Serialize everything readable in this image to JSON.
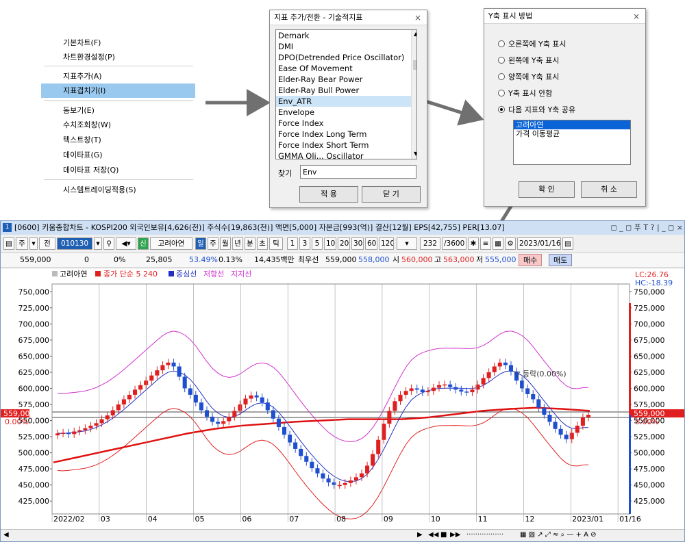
{
  "context_menu": {
    "items": [
      {
        "label": "기본차트(F)"
      },
      {
        "label": "차트환경설정(P)"
      },
      {
        "label": "지표추가(A)"
      },
      {
        "label": "지표겹치기(I)"
      },
      {
        "label": "동보기(E)"
      },
      {
        "label": "수치조회창(W)"
      },
      {
        "label": "텍스트창(T)"
      },
      {
        "label": "데이타표(G)"
      },
      {
        "label": "데이타표 저장(Q)"
      },
      {
        "label": "시스템트레이딩적용(S)"
      }
    ]
  },
  "indicator_dialog": {
    "title": "지표 추가/전환 - 기술적지표",
    "close": "×",
    "items": [
      "Demark",
      "DMI",
      "DPO(Detrended Price Oscillator)",
      "Ease Of Movement",
      "Elder-Ray Bear Power",
      "Elder-Ray Bull Power",
      "Env_ATR",
      "Envelope",
      "Force Index",
      "Force Index Long Term",
      "Force Index Short Term",
      "GMMA Oli... Oscillator"
    ],
    "find_label": "찾기",
    "find_value": "Env",
    "apply_label": "적 용",
    "close_label": "닫 기"
  },
  "yaxis_dialog": {
    "title": "Y축 표시 방법",
    "close": "×",
    "options": [
      "오른쪽에 Y축 표시",
      "왼쪽에 Y축 표시",
      "양쪽에 Y축 표시",
      "Y축 표시 안함",
      "다음 지표와 Y축 공유"
    ],
    "share_items": [
      "고려아연",
      "가격 이동평균"
    ],
    "ok_label": "확 인",
    "cancel_label": "취 소"
  },
  "main": {
    "title": "[0600] 키움종합차트 - KOSPI200 외국인보유[4,626(천)] 주식수[19,863(천)] 액면[5,000] 자본금[993(억)] 결산[12월] EPS[42,755] PER[13.07]",
    "win_icon": "1",
    "win_controls": "◻ _ ◻ 푸 T ? | _ ◻ ×",
    "toolbar": {
      "week": "주",
      "jeon": "전",
      "code": "010130",
      "shin": "신",
      "name": "고려아연",
      "il": "일",
      "ju": "주",
      "wol": "월",
      "nyeon": "년",
      "bun": "분",
      "cho": "초",
      "tick": "틱",
      "periods": [
        "1",
        "3",
        "5",
        "10",
        "20",
        "30",
        "60",
        "120"
      ],
      "count": "232",
      "total": "/3600",
      "date": "2023/01/16"
    },
    "quote": {
      "price": "559,000",
      "change": "0",
      "rate": "0%",
      "volume": "25,805",
      "vol_ratio": "53.49%",
      "turnover": "0.13%",
      "amount": "14,435백만",
      "prev_label": "최우선",
      "ask": "559,000",
      "bid": "558,000",
      "open_label": "시",
      "open": "560,000",
      "high_label": "고",
      "high": "563,000",
      "low_label": "저",
      "low": "555,000",
      "buy": "매수",
      "sell": "매도"
    }
  },
  "chart_data": {
    "type": "candlestick",
    "ticker": "고려아연",
    "legend": [
      "고려아연",
      "종가 단순 5 240",
      "중심선",
      "저항선",
      "지지선"
    ],
    "y_ticks": [
      750000,
      725000,
      700000,
      675000,
      650000,
      625000,
      600000,
      575000,
      550000,
      525000,
      500000,
      475000,
      450000,
      425000
    ],
    "y_tick_labels": [
      "750,000",
      "725,000",
      "700,000",
      "675,000",
      "650,000",
      "625,000",
      "600,000",
      "575,000",
      "550,000",
      "525,000",
      "500,000",
      "475,000",
      "450,000",
      "425,000"
    ],
    "ylim": [
      405000,
      762000
    ],
    "last_price": 559000,
    "last_price_label": "559,000",
    "zero_pct_label": "0.00%",
    "lc_label": "LC:26.76",
    "hc_label": "HC:-18.39",
    "annotation": "▽ 등락(0.00%)",
    "x_labels": [
      "2022/02",
      "03",
      "04",
      "05",
      "06",
      "07",
      "08",
      "09",
      "10",
      "11",
      "12",
      "2023/01",
      "01/16"
    ],
    "close": [
      530000,
      531000,
      529000,
      533000,
      535000,
      538000,
      542000,
      546000,
      552000,
      558000,
      566000,
      575000,
      583000,
      590000,
      598000,
      605000,
      612000,
      620000,
      628000,
      636000,
      640000,
      634000,
      618000,
      600000,
      590000,
      578000,
      566000,
      556000,
      548000,
      545000,
      549000,
      556000,
      565000,
      575000,
      584000,
      589000,
      586000,
      578000,
      566000,
      553000,
      540000,
      528000,
      516000,
      506000,
      495000,
      486000,
      476000,
      468000,
      460000,
      454000,
      450000,
      450000,
      453000,
      457000,
      462000,
      468000,
      480000,
      498000,
      520000,
      545000,
      565000,
      580000,
      590000,
      596000,
      600000,
      598000,
      594000,
      596000,
      601000,
      605000,
      606000,
      602000,
      598000,
      595000,
      594000,
      598000,
      606000,
      616000,
      625000,
      634000,
      640000,
      636000,
      626000,
      612000,
      600000,
      591000,
      583000,
      570000,
      559000,
      548000,
      537000,
      528000,
      521000,
      531000,
      542000,
      555000,
      559000
    ],
    "close_labels": [
      "530,000",
      "531,000",
      "529,000",
      "533,000",
      "535,000",
      "538,000",
      "542,000",
      "546,000",
      "552,000",
      "558,000",
      "566,000",
      "575,000",
      "583,000",
      "590,000",
      "598,000",
      "605,000",
      "612,000",
      "620,000",
      "628,000",
      "636,000",
      "640,000",
      "634,000",
      "618,000",
      "600,000",
      "590,000",
      "578,000",
      "566,000",
      "556,000",
      "548,000",
      "545,000",
      "549,000",
      "556,000",
      "565,000",
      "575,000",
      "584,000",
      "589,000",
      "586,000",
      "578,000",
      "566,000",
      "553,000",
      "540,000",
      "528,000",
      "516,000",
      "506,000",
      "495,000",
      "486,000",
      "476,000",
      "468,000",
      "460,000",
      "454,000",
      "450,000",
      "450,000",
      "453,000",
      "457,000",
      "462,000",
      "468,000",
      "480,000",
      "498,000",
      "520,000",
      "545,000",
      "565,000",
      "580,000",
      "590,000",
      "596,000",
      "600,000",
      "598,000",
      "594,000",
      "596,000",
      "601,000",
      "605,000",
      "606,000",
      "602,000",
      "598,000",
      "595,000",
      "594,000",
      "598,000",
      "606,000",
      "616,000",
      "625,000",
      "634,000",
      "640,000",
      "636,000",
      "626,000",
      "612,000",
      "600,000",
      "591,000",
      "583,000",
      "570,000",
      "559,000",
      "548,000",
      "537,000",
      "528,000",
      "521,000",
      "531,000",
      "542,000",
      "555,000",
      "559,000"
    ],
    "ma240": [
      485000,
      494000,
      503000,
      512000,
      521000,
      530000,
      537000,
      542000,
      545000,
      548000,
      550000,
      552000,
      552000,
      552000,
      555000,
      560000,
      565000,
      568000,
      570000,
      568000,
      565000
    ],
    "ma240_labels": [
      "485,000",
      "494,000",
      "503,000",
      "512,000",
      "521,000",
      "530,000",
      "537,000",
      "542,000",
      "545,000",
      "548,000",
      "550,000",
      "552,000",
      "552,000",
      "552,000",
      "555,000",
      "560,000",
      "565,000",
      "568,000",
      "570,000",
      "568,000",
      "565,000"
    ],
    "colors": {
      "up": "#e02020",
      "down": "#1f4fd0",
      "ma": "#e01010",
      "mid": "#2030c0",
      "band": "#d030d0",
      "band_red": "#e02020"
    }
  }
}
